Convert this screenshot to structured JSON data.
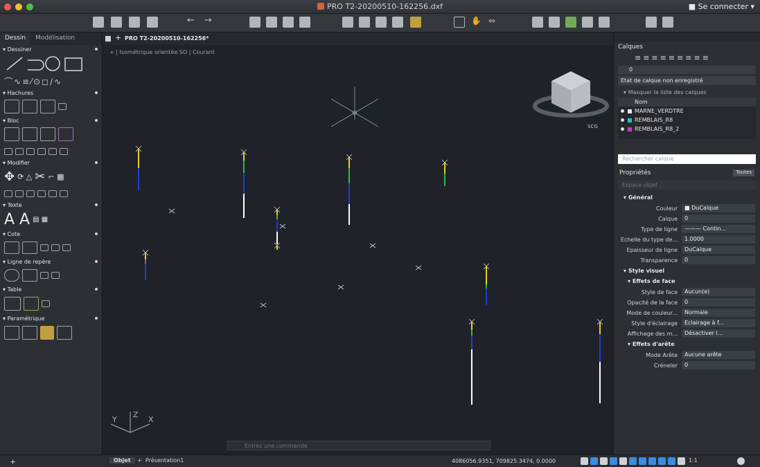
{
  "titlebar": {
    "title": "PRO T2-20200510-162256.dxf",
    "connect": "Se connecter"
  },
  "left_panel": {
    "tabs": [
      "Dessin",
      "Modélisation"
    ],
    "sections": {
      "dessiner": "Dessiner",
      "hachures": "Hachures",
      "bloc": "Bloc",
      "modifier": "Modifier",
      "texte": "Texte",
      "cote": "Cote",
      "repere": "Ligne de repère",
      "table": "Table",
      "param": "Paramétrique"
    }
  },
  "canvas": {
    "doc_tab": "PRO T2-20200510-162256*",
    "view_label": "+ | Isométrique orientée SO | Courant",
    "viewcube_label": "SCG",
    "command_placeholder": "Entrez une commande"
  },
  "right_panel": {
    "layers_title": "Calques",
    "current_layer": "0",
    "state": "Etat de calque non enregistré",
    "mask": "Masquer la liste des calques",
    "name_header": "Nom",
    "layers": [
      {
        "name": "MARNE_VERDTRE",
        "color": "#e6e8ea"
      },
      {
        "name": "REMBLAIS_R8",
        "color": "#22c6c6"
      },
      {
        "name": "REMBLAIS_R8_2",
        "color": "#c040c0"
      }
    ],
    "search_placeholder": "Rechercher calque",
    "props_title": "Propriétés",
    "props_filter": "Toutes",
    "espace": "Espace objet",
    "general": "Général",
    "props_general": [
      {
        "k": "Couleur",
        "v": "■ DuCalque"
      },
      {
        "k": "Calque",
        "v": "0"
      },
      {
        "k": "Type de ligne",
        "v": "——— Contin..."
      },
      {
        "k": "Echelle du type de...",
        "v": "1.0000"
      },
      {
        "k": "Epaisseur de ligne",
        "v": "DuCalque"
      },
      {
        "k": "Transparence",
        "v": "0"
      }
    ],
    "style_visuel": "Style visuel",
    "effets_face": "Effets de face",
    "props_face": [
      {
        "k": "Style de face",
        "v": "Aucun(e)"
      },
      {
        "k": "Opacité de la face",
        "v": "0"
      },
      {
        "k": "Mode de couleur...",
        "v": "Normale"
      },
      {
        "k": "Style d'éclairage",
        "v": "Eclairage à f..."
      },
      {
        "k": "Affichage des m...",
        "v": "Désactiver l..."
      }
    ],
    "effets_arete": "Effets d'arête",
    "props_arete": [
      {
        "k": "Mode Arête",
        "v": "Aucune arête"
      },
      {
        "k": "Créneler",
        "v": "0"
      }
    ]
  },
  "status": {
    "tab_objet": "Objet",
    "tab_pres": "Présentation1",
    "coords": "4086056.9351, 709825.3474, 0.0000",
    "scale": "1:1"
  }
}
